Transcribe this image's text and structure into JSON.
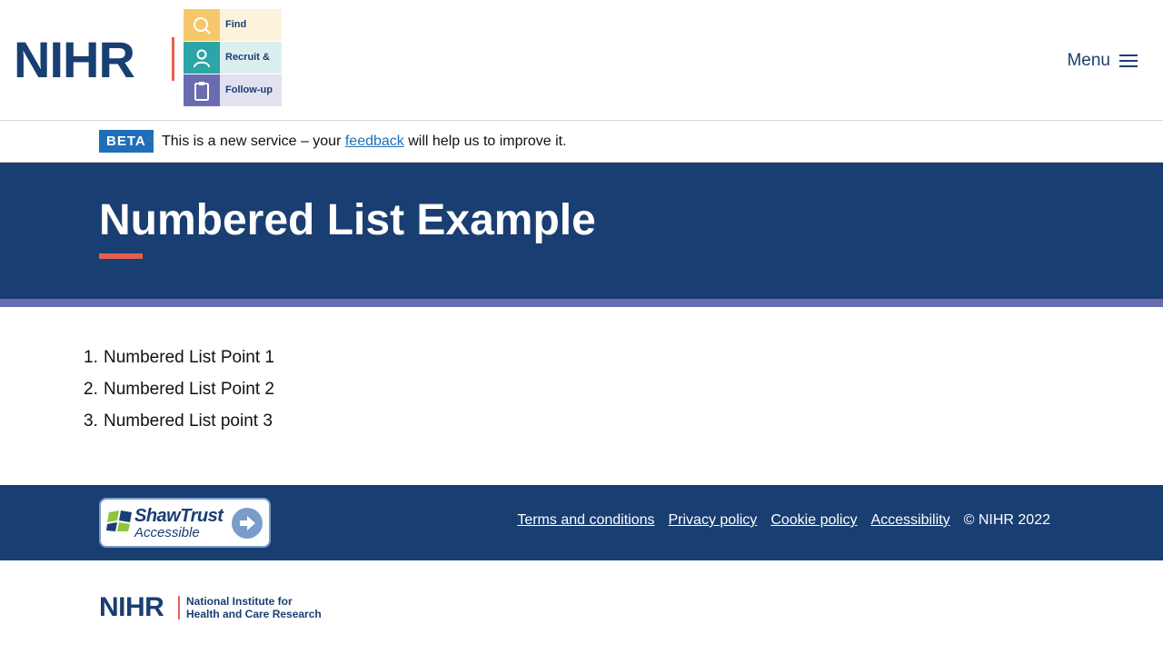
{
  "header": {
    "logo": {
      "brand": "NIHR",
      "steps": [
        {
          "label": "Find",
          "icon": "search-icon"
        },
        {
          "label": "Recruit &",
          "icon": "person-icon"
        },
        {
          "label": "Follow-up",
          "icon": "clipboard-icon"
        }
      ]
    },
    "menu_label": "Menu"
  },
  "beta_banner": {
    "tag": "BETA",
    "text_before": "This is a new service – your ",
    "link_text": "feedback",
    "text_after": " will help us to improve it."
  },
  "hero": {
    "title": "Numbered List Example"
  },
  "main": {
    "list": [
      {
        "number": "1.",
        "text": "Numbered List Point 1"
      },
      {
        "number": "2.",
        "text": "Numbered List Point 2"
      },
      {
        "number": "3.",
        "text": "Numbered List point 3"
      }
    ]
  },
  "footer": {
    "badge": {
      "title": "ShawTrust",
      "subtitle": "Accessible"
    },
    "links": [
      "Terms and conditions",
      "Privacy policy",
      "Cookie policy",
      "Accessibility"
    ],
    "copyright": "© NIHR 2022"
  },
  "bottom_logo": {
    "brand": "NIHR",
    "line1": "National Institute for",
    "line2": "Health and Care Research"
  },
  "colors": {
    "primary_navy": "#193e72",
    "accent_coral": "#e5614d",
    "accent_purple": "#6a6cb0",
    "beta_blue": "#1f6fb8",
    "step_yellow": "#f7c86b",
    "step_teal": "#2ba5a7"
  }
}
